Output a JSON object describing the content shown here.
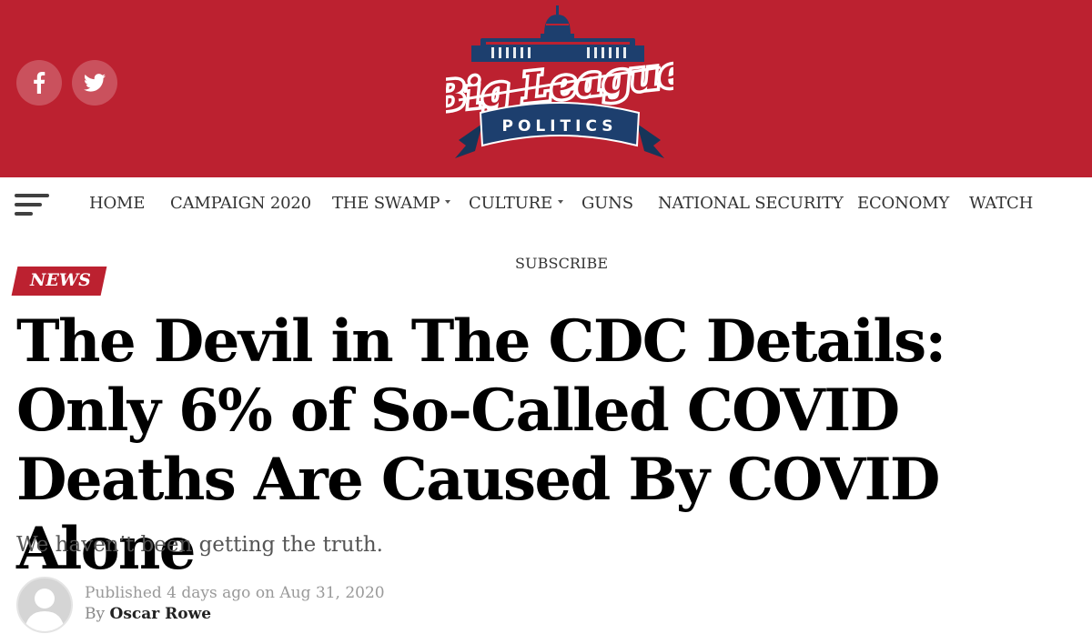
{
  "header": {
    "brand_line1": "Big League",
    "brand_line2": "POLITICS",
    "social": [
      {
        "icon": "facebook-icon",
        "glyph": "f"
      },
      {
        "icon": "twitter-icon",
        "glyph": "bird"
      }
    ],
    "colors": {
      "brand_red": "#bc2130",
      "brand_navy": "#1d3f6e"
    }
  },
  "nav": {
    "menu_icon": "hamburger-menu-icon",
    "items": [
      {
        "label": "HOME",
        "dropdown": false
      },
      {
        "label": "CAMPAIGN 2020",
        "dropdown": false
      },
      {
        "label": "THE SWAMP",
        "dropdown": true
      },
      {
        "label": "CULTURE",
        "dropdown": true
      },
      {
        "label": "GUNS",
        "dropdown": false
      },
      {
        "label": "NATIONAL SECURITY",
        "dropdown": false
      },
      {
        "label": "ECONOMY",
        "dropdown": false
      },
      {
        "label": "WATCH",
        "dropdown": false
      }
    ],
    "subscribe": "SUBSCRIBE"
  },
  "article": {
    "category": "NEWS",
    "title": "The Devil in The CDC Details: Only 6% of So-Called COVID Deaths Are Caused By COVID Alone",
    "subtitle": "We haven’t been getting the truth.",
    "meta": {
      "published_prefix": "Published",
      "time_ago": "4 days ago",
      "on": "on",
      "date": "Aug 31, 2020",
      "by_prefix": "By",
      "author": "Oscar Rowe"
    }
  }
}
